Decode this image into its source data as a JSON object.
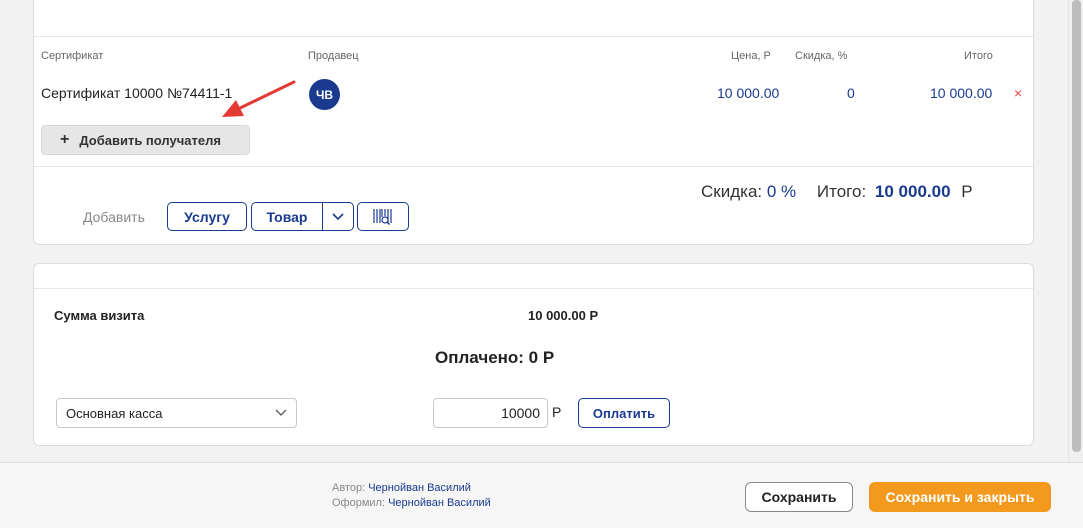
{
  "table": {
    "headers": {
      "certificate": "Сертификат",
      "seller": "Продавец",
      "price": "Цена, Р",
      "discount": "Скидка, %",
      "total": "Итого"
    },
    "rows": [
      {
        "certificate": "Сертификат 10000 №74411-1",
        "seller_initials": "ЧВ",
        "price": "10 000.00",
        "discount": "0",
        "total": "10 000.00",
        "remove_icon": "×"
      }
    ]
  },
  "add_recipient_button": {
    "icon": "+",
    "label": "Добавить получателя"
  },
  "add_bar": {
    "label": "Добавить",
    "service_button": "Услугу",
    "product_button": "Товар",
    "dropdown_icon": "chevron-down-icon",
    "barcode_icon": "barcode-scan-icon"
  },
  "totals": {
    "discount_label": "Скидка:",
    "discount_value": "0 %",
    "total_label": "Итого:",
    "total_value": "10 000.00",
    "currency": "Р"
  },
  "payment": {
    "visit_sum_label": "Сумма визита",
    "visit_sum_value": "10 000.00 Р",
    "paid_text": "Оплачено: 0 Р",
    "cash_register": "Основная касса",
    "amount": "10000",
    "currency": "Р",
    "pay_button": "Оплатить"
  },
  "footer": {
    "author_label": "Автор:",
    "author_name": "Чернойван Василий",
    "issued_label": "Оформил:",
    "issued_name": "Чернойван Василий",
    "save_button": "Сохранить",
    "save_close_button": "Сохранить и закрыть"
  },
  "colors": {
    "accent": "#1a3a8f",
    "primary_button": "#f39a1e",
    "remove": "#ee4444",
    "annotation_arrow": "#e53935"
  }
}
